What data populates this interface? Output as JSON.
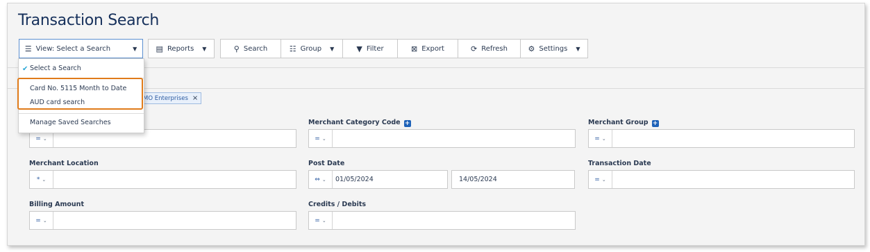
{
  "page": {
    "title": "Transaction Search"
  },
  "toolbar": {
    "view_label": "View: Select a Search",
    "reports_label": "Reports",
    "search_label": "Search",
    "group_label": "Group",
    "filter_label": "Filter",
    "export_label": "Export",
    "refresh_label": "Refresh",
    "settings_label": "Settings"
  },
  "view_dropdown": {
    "selected": "Select a Search",
    "items": [
      "Card No. 5115 Month to Date",
      "AUD card search"
    ],
    "manage": "Manage Saved Searches"
  },
  "chip": {
    "label": "MO Enterprises",
    "close": "×"
  },
  "fields": {
    "merchant_category_code": {
      "label": "Merchant Category Code",
      "op": "="
    },
    "merchant_group": {
      "label": "Merchant Group",
      "op": "="
    },
    "merchant_location": {
      "label": "Merchant Location",
      "op": "*"
    },
    "post_date": {
      "label": "Post Date",
      "op": "⇔",
      "from": "01/05/2024",
      "to": "14/05/2024"
    },
    "transaction_date": {
      "label": "Transaction Date",
      "op": "="
    },
    "billing_amount": {
      "label": "Billing Amount",
      "op": "="
    },
    "credits_debits": {
      "label": "Credits / Debits",
      "op": "="
    },
    "top_left": {
      "op": "="
    }
  },
  "colors": {
    "accent": "#1e62b8",
    "highlight": "#e07b1a",
    "check": "#2aa7d6",
    "title": "#16305b"
  }
}
